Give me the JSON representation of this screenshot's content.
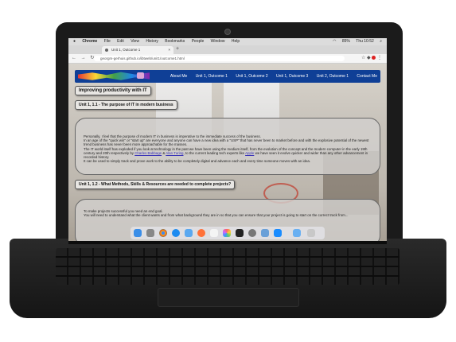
{
  "menubar": {
    "apple": "",
    "items": [
      "Chrome",
      "File",
      "Edit",
      "View",
      "History",
      "Bookmarks",
      "People",
      "Window",
      "Help"
    ],
    "status": [
      "85%",
      "Thu 10:52"
    ]
  },
  "browser": {
    "tab_title": "Unit 1, Outcome 1",
    "tab_close": "×",
    "new_tab": "+",
    "url": "georgm-gerhuis.github.io/ibtweb/unit1/outcome1.html",
    "back": "←",
    "forward": "→",
    "reload": "↻",
    "star": "☆"
  },
  "site": {
    "nav_links": [
      "About Me",
      "Unit 1, Outcome 1",
      "Unit 1, Outcome 2",
      "Unit 1, Outcome 3",
      "Unit 2, Outcome 1",
      "Contact Me"
    ],
    "main_heading": "Improving productivity with IT",
    "section1_heading": "Unit 1, 1.1 - The purpose of IT in modern business",
    "section1_paragraphs": [
      "Personally, I feel that the purpose of modern IT in business is imperative to the immediate success of the business.",
      "In an age of the \"quick win\" or \"start up\" are everyone and anyone can have a new idea with a \"USP\" that has never been to market before and with the explosive potential of the newest trend business has never been more approachable for the masses.",
      "The IT world itself has exploded if you look at technology in the past we have been using the medium itself, from the evolution of the concept and the modern computer in the early 19th century and 20th respectively by ",
      "Charles Babbage",
      " & ",
      "Alan Turing",
      ", to the current leading tech experts like ",
      "Apple",
      " we have seen it evolve quicker and wider than any other advancement in recorded history.",
      "It can be used to simply track and prove work to the ability to be completely digital and advance each and every time someone moves with an idea."
    ],
    "section2_heading": "Unit 1, 1.2 - What Methods, Skills & Resources are needed to complete projects?",
    "section2_paragraphs": [
      "To make projects successful you need an end goal.",
      "You will need to understand what the client wants and from what background they are in so that you can ensure that your project is going to start on the correct track from..."
    ]
  },
  "colors": {
    "nav_bg": "#0f3f96",
    "link": "#3a34b8",
    "heading_bg": "#e8e6e3"
  },
  "dock_icons": [
    "finder-icon",
    "launchpad-icon",
    "chrome-icon",
    "safari-icon",
    "mail-icon",
    "firefox-icon",
    "calendar-icon",
    "photos-icon",
    "terminal-icon",
    "settings-icon",
    "preview-icon",
    "appstore-icon",
    "folder-icon",
    "trash-icon"
  ]
}
